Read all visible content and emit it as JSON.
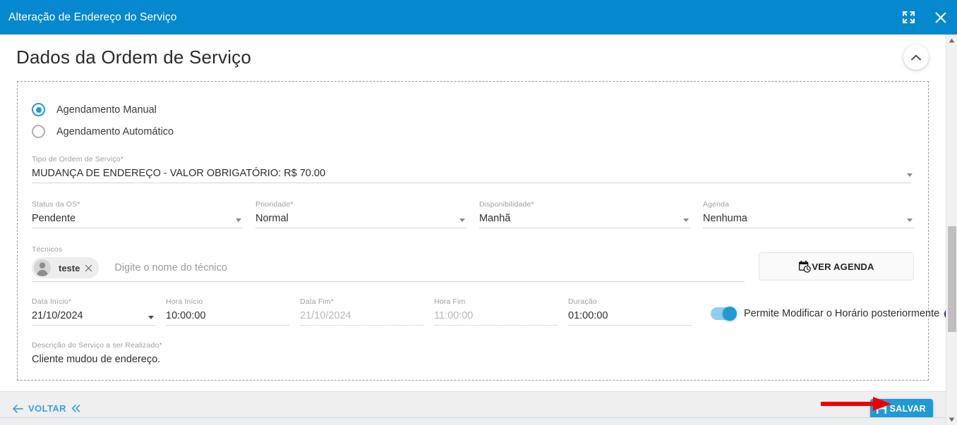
{
  "window": {
    "title": "Alteração de Endereço do Serviço",
    "restore_icon": "expand-arrows-icon",
    "close_icon": "close-icon"
  },
  "colors": {
    "header_blue": "#0588ce",
    "accent_blue": "#1f9ad6",
    "link_blue": "#3ba3e0",
    "help_navy": "#14307e",
    "annotation_red": "#ee0000",
    "footer_gray": "#efefef"
  },
  "page": {
    "title": "Dados da Ordem de Serviço",
    "collapse_icon": "chevron-up-icon"
  },
  "form": {
    "scheduling_options": [
      {
        "label": "Agendamento Manual",
        "selected": true
      },
      {
        "label": "Agendamento Automático",
        "selected": false
      }
    ],
    "tipo_os": {
      "label": "Tipo de Ordem de Serviço",
      "required": "*",
      "value": "MUDANÇA DE ENDEREÇO - VALOR OBRIGATÓRIO: R$ 70.00"
    },
    "selects": [
      {
        "label": "Status da OS",
        "required": "*",
        "value": "Pendente"
      },
      {
        "label": "Prioridade",
        "required": "*",
        "value": "Normal"
      },
      {
        "label": "Disponibilidade",
        "required": "*",
        "value": "Manhã"
      },
      {
        "label": "Agenda",
        "required": "",
        "value": "Nenhuma"
      }
    ],
    "tecnicos": {
      "label": "Técnicos",
      "chip": {
        "name": "teste",
        "avatar_icon": "user-avatar-icon",
        "remove_icon": "close-icon"
      },
      "placeholder": "Digite o nome do técnico"
    },
    "ver_agenda": {
      "label": "VER AGENDA",
      "icon": "calendar-clock-icon"
    },
    "datetime": [
      {
        "label": "Data Início",
        "required": "*",
        "value": "21/10/2024",
        "disabled": false,
        "has_caret": true
      },
      {
        "label": "Hora Início",
        "required": "",
        "value": "10:00:00",
        "disabled": false,
        "has_caret": false
      },
      {
        "label": "Data Fim",
        "required": "*",
        "value": "21/10/2024",
        "disabled": true,
        "has_caret": false
      },
      {
        "label": "Hora Fim",
        "required": "",
        "value": "11:00:00",
        "disabled": true,
        "has_caret": false
      },
      {
        "label": "Duração",
        "required": "",
        "value": "01:00:00",
        "disabled": false,
        "has_caret": false
      }
    ],
    "permite_modificar": {
      "label": "Permite Modificar o Horário posteriormente",
      "enabled": true,
      "help_glyph": "?",
      "help_icon": "help-circle-icon"
    },
    "descricao": {
      "label": "Descrição do Serviço a ser Realizado",
      "required": "*",
      "value": "Cliente mudou de endereço."
    }
  },
  "footer": {
    "back": {
      "label": "VOLTAR",
      "left_icon": "arrow-left-icon",
      "right_icon": "double-chevron-left-icon"
    },
    "save": {
      "label": "SALVAR",
      "icon": "save-floppy-icon"
    }
  },
  "annotation": {
    "type": "red-arrow-pointing-right",
    "target": "SALVAR"
  },
  "scrollbar": {
    "up_icon": "triangle-up-icon",
    "down_icon": "triangle-down-icon"
  },
  "bottom_strip": {
    "text": ""
  }
}
